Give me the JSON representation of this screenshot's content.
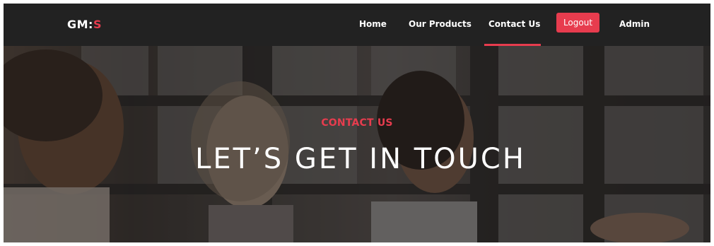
{
  "brand": {
    "logo_prefix": "GM:",
    "logo_suffix": "S"
  },
  "nav": {
    "home": "Home",
    "products": "Our Products",
    "contact": "Contact Us",
    "logout": "Logout",
    "admin": "Admin",
    "active_item": "Contact Us"
  },
  "hero": {
    "eyebrow": "CONTACT US",
    "headline": "LET’S GET IN TOUCH"
  },
  "colors": {
    "accent": "#e73c4e",
    "navbar_bg": "#222222",
    "text": "#ffffff"
  }
}
